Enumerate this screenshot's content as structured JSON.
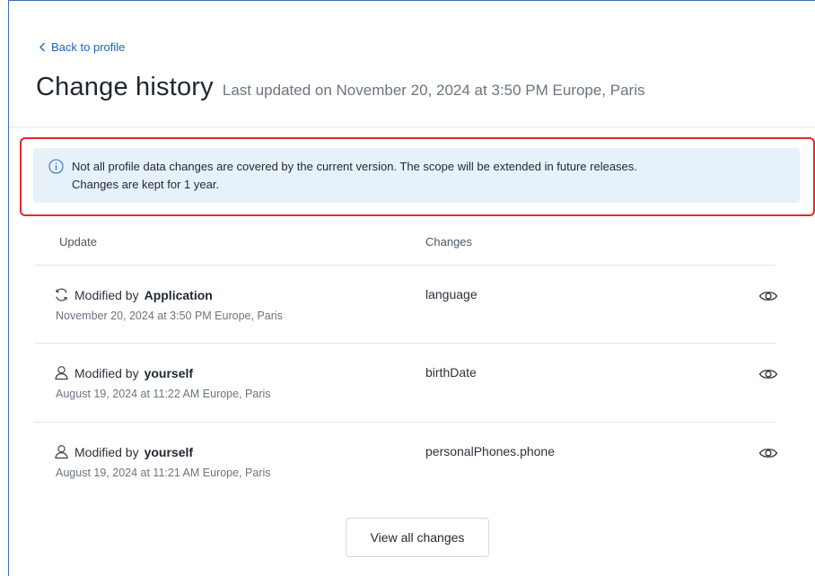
{
  "nav": {
    "back_label": "Back to profile"
  },
  "header": {
    "title": "Change history",
    "last_updated": "Last updated on November 20, 2024 at 3:50 PM Europe, Paris"
  },
  "banner": {
    "icon": "info-icon",
    "line1": "Not all profile data changes are covered by the current version. The scope will be extended in future releases.",
    "line2": "Changes are kept for 1 year.",
    "highlight_color": "#e02a2a",
    "background": "#e7f1fa"
  },
  "table": {
    "columns": [
      "Update",
      "Changes"
    ],
    "rows": [
      {
        "icon": "sync-icon",
        "prefix": "Modified by",
        "actor": "Application",
        "date": "November 20, 2024 at 3:50 PM Europe, Paris",
        "change": "language",
        "action_icon": "eye-icon"
      },
      {
        "icon": "user-icon",
        "prefix": "Modified by",
        "actor": "yourself",
        "date": "August 19, 2024 at 11:22 AM Europe, Paris",
        "change": "birthDate",
        "action_icon": "eye-icon"
      },
      {
        "icon": "user-icon",
        "prefix": "Modified by",
        "actor": "yourself",
        "date": "August 19, 2024 at 11:21 AM Europe, Paris",
        "change": "personalPhones.phone",
        "action_icon": "eye-icon"
      }
    ]
  },
  "footer": {
    "view_all_label": "View all changes"
  },
  "colors": {
    "link": "#1a62c6",
    "frame_border": "#3d6fb8"
  }
}
